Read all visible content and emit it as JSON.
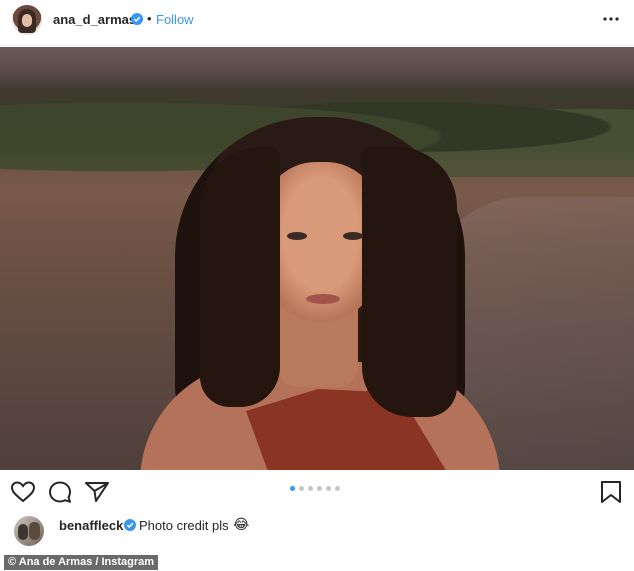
{
  "post": {
    "author": "ana_d_armas",
    "separator": "•",
    "follow_label": "Follow",
    "carousel": {
      "total": 6,
      "active_index": 0
    }
  },
  "comment": {
    "user": "benaffleck",
    "text": "Photo credit pls",
    "emoji": "😂"
  },
  "watermark": "© Ana de Armas / Instagram",
  "colors": {
    "accent": "#3897f0",
    "verified": "#3897f0",
    "text": "#262626"
  },
  "icons": {
    "more": "ellipsis-icon",
    "like": "heart-icon",
    "comment": "comment-bubble-icon",
    "share": "paper-plane-icon",
    "save": "bookmark-icon",
    "verified": "verified-badge-icon"
  }
}
